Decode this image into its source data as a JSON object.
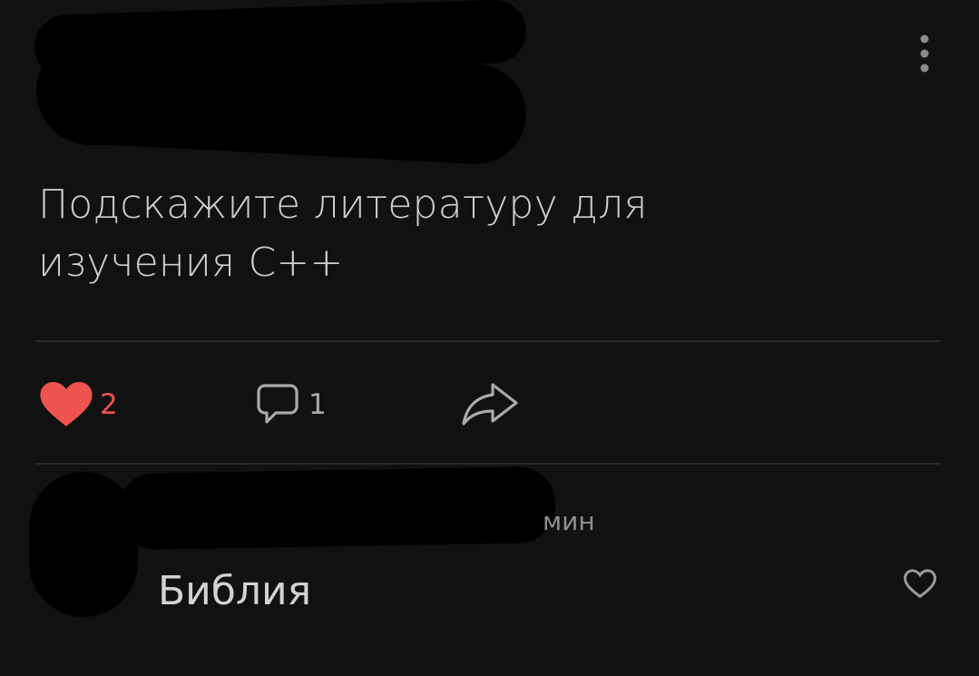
{
  "post": {
    "text": "Подскажите литературу для изучения С++",
    "likes": "2",
    "comments": "1",
    "like_color": "#ef5350"
  },
  "comment": {
    "time": "мин",
    "text": "Библия"
  },
  "icons": {
    "menu": "more-vertical-icon",
    "like": "heart-filled-icon",
    "comment": "comment-bubble-icon",
    "share": "share-arrow-icon",
    "comment_like": "heart-outline-icon"
  }
}
